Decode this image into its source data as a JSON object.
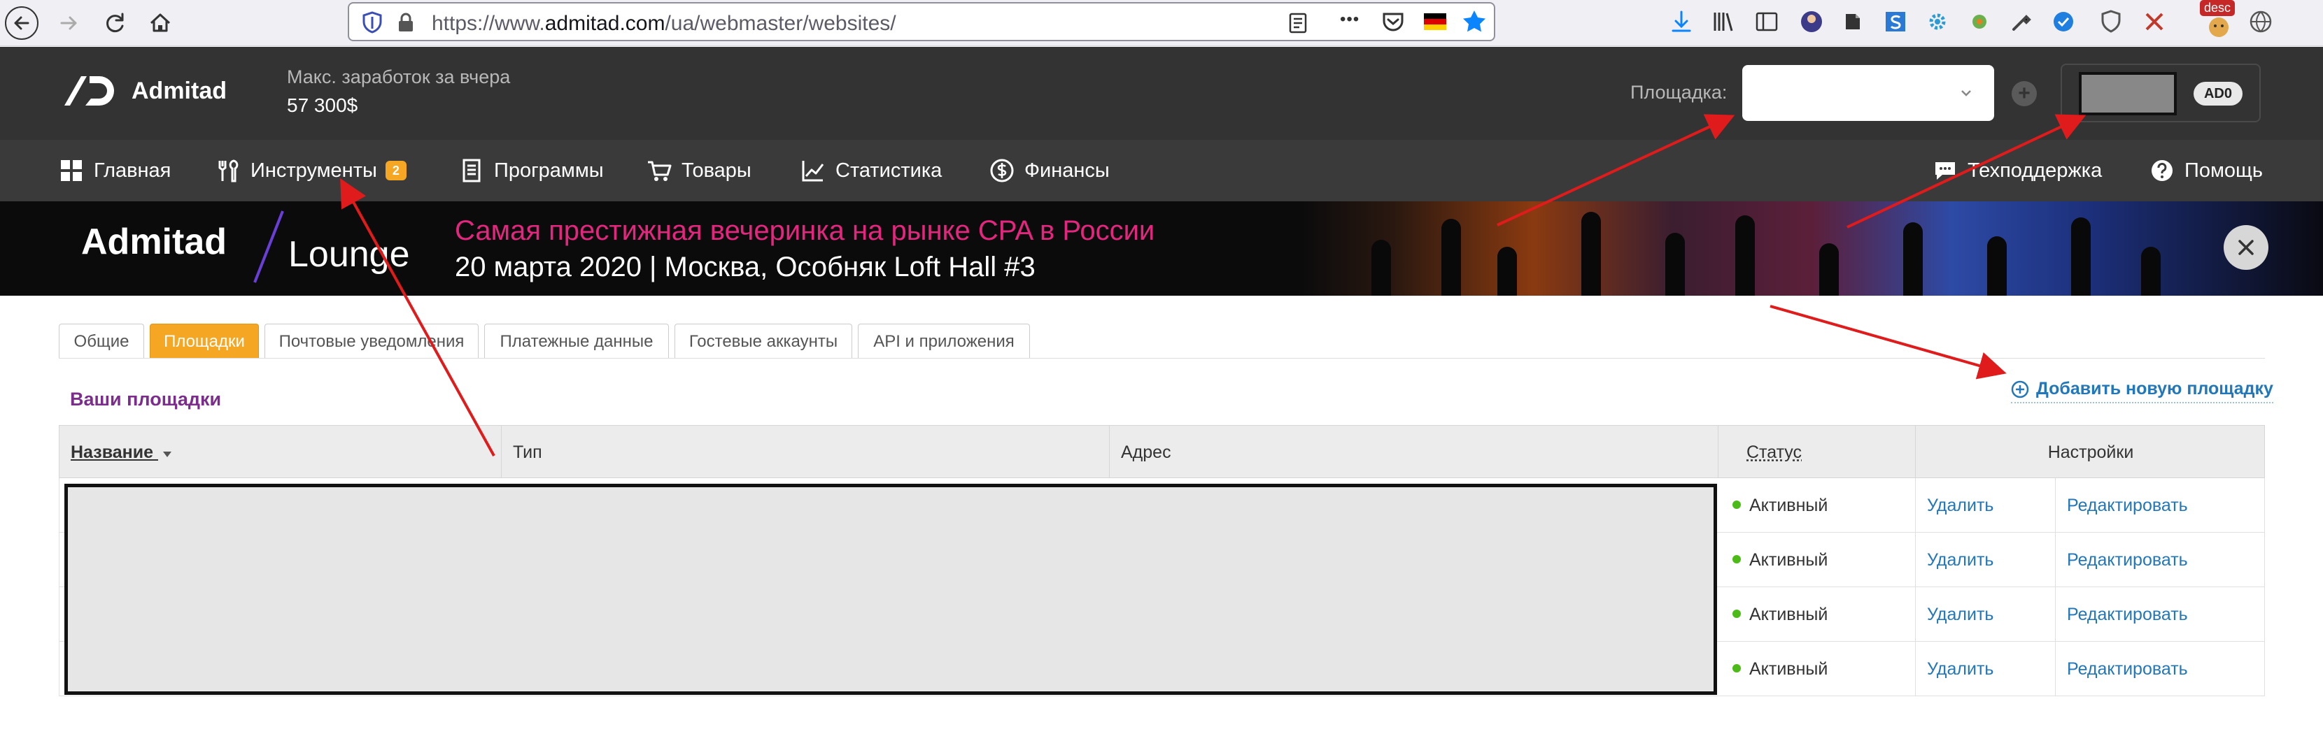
{
  "browser": {
    "url_prefix": "https://www.",
    "url_domain": "admitad.com",
    "url_path": "/ua/webmaster/websites/",
    "ext_badge": "desc",
    "more_label": "•••"
  },
  "header": {
    "logo_text": "Admitad",
    "earnings_label": "Макс. заработок за вчера",
    "earnings_value": "57 300$",
    "platform_label": "Площадка:",
    "platform_value": "",
    "account_tag": "AD0"
  },
  "nav": {
    "items": [
      {
        "label": "Главная",
        "icon": "grid-icon"
      },
      {
        "label": "Инструменты",
        "icon": "tools-icon",
        "badge": "2"
      },
      {
        "label": "Программы",
        "icon": "document-icon"
      },
      {
        "label": "Товары",
        "icon": "cart-icon"
      },
      {
        "label": "Статистика",
        "icon": "chart-icon"
      },
      {
        "label": "Финансы",
        "icon": "dollar-icon"
      }
    ],
    "support_label": "Техподдержка",
    "help_label": "Помощь"
  },
  "banner": {
    "brand": "Admitad",
    "lounge": "Lounge",
    "title": "Самая престижная вечеринка на рынке CPA в России",
    "subtitle": "20 марта 2020 | Москва, Особняк Loft Hall #3"
  },
  "tabs": [
    {
      "label": "Общие",
      "active": false
    },
    {
      "label": "Площадки",
      "active": true
    },
    {
      "label": "Почтовые уведомления",
      "active": false
    },
    {
      "label": "Платежные данные",
      "active": false
    },
    {
      "label": "Гостевые аккаунты",
      "active": false
    },
    {
      "label": "API и приложения",
      "active": false
    }
  ],
  "section": {
    "title": "Ваши площадки",
    "add_label": "Добавить новую площадку"
  },
  "table": {
    "headers": {
      "name": "Название",
      "type": "Тип",
      "address": "Адрес",
      "status": "Статус",
      "settings": "Настройки"
    },
    "rows": [
      {
        "status": "Активный",
        "delete": "Удалить",
        "edit": "Редактировать"
      },
      {
        "status": "Активный",
        "delete": "Удалить",
        "edit": "Редактировать"
      },
      {
        "status": "Активный",
        "delete": "Удалить",
        "edit": "Редактировать"
      },
      {
        "status": "Активный",
        "delete": "Удалить",
        "edit": "Редактировать"
      }
    ]
  },
  "colors": {
    "accent": "#f5a623",
    "link": "#2277bb",
    "status_active": "#4cbb17",
    "annotation": "#e01b1b"
  }
}
